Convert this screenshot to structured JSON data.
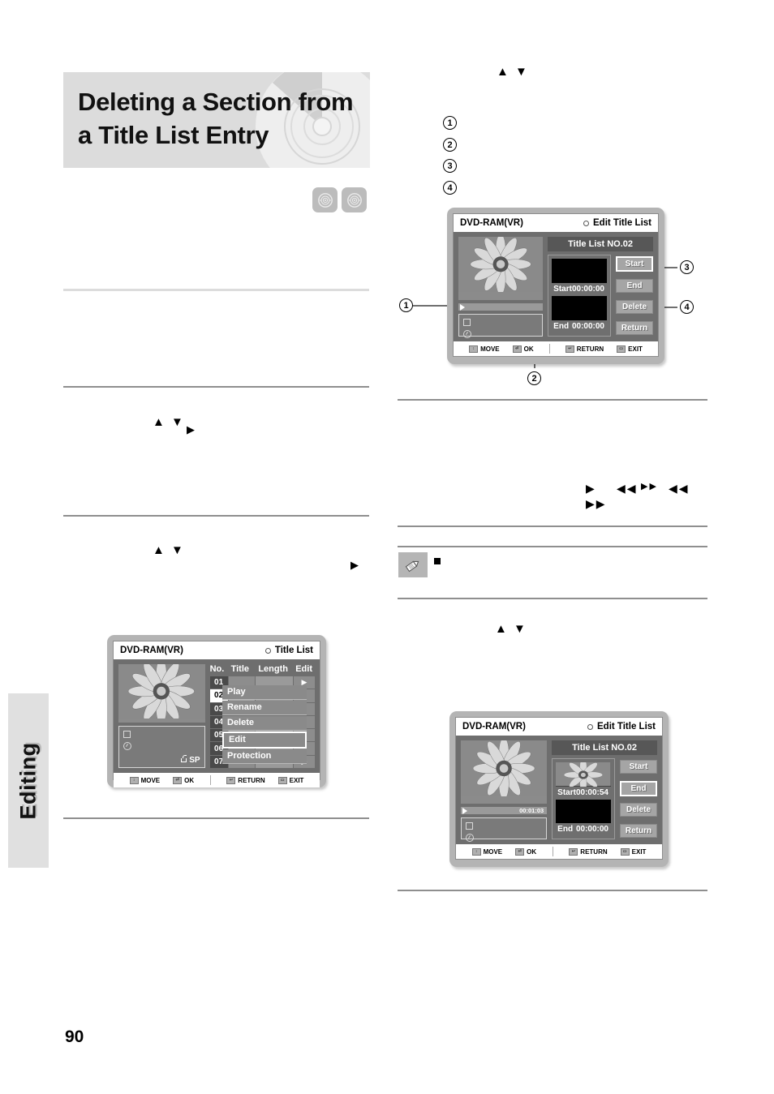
{
  "page": {
    "number": "90",
    "side_tab": "Editing",
    "title": "Deleting a Section from a Title List Entry",
    "title_line1": "Deleting a Section from",
    "title_line2": "a Title List Entry"
  },
  "disc_badges": [
    {
      "name": "dvd-ram-badge"
    },
    {
      "name": "dvd-rw-badge"
    }
  ],
  "markers": {
    "one": "1",
    "two": "2",
    "three": "3",
    "four": "4"
  },
  "glyphs": {
    "up_down": "▲ ▼",
    "right": "▶",
    "play": "▶",
    "rew": "◀◀",
    "ff_small": "▶▶",
    "rew_wide": "◀◀",
    "ff_wide": "▶▶"
  },
  "osd_common": {
    "device": "DVD-RAM(VR)",
    "footer": [
      {
        "key": "↕",
        "label": "MOVE"
      },
      {
        "key": "⏎",
        "label": "OK"
      },
      {
        "key": "↩",
        "label": "RETURN"
      },
      {
        "key": "▭",
        "label": "EXIT"
      }
    ]
  },
  "osd_edit_top": {
    "device": "DVD-RAM(VR)",
    "screen_title": "Edit Title List",
    "list_header": "Title List NO.02",
    "start_label": "Start",
    "start_time": "00:00:00",
    "end_label": "End",
    "end_time": "00:00:00",
    "buttons": [
      {
        "label": "Start",
        "selected": true
      },
      {
        "label": "End",
        "selected": false
      },
      {
        "label": "Delete",
        "selected": false
      },
      {
        "label": "Return",
        "selected": false
      }
    ],
    "progress_time": ""
  },
  "osd_edit_bottom": {
    "device": "DVD-RAM(VR)",
    "screen_title": "Edit Title List",
    "list_header": "Title List NO.02",
    "start_label": "Start",
    "start_time": "00:00:54",
    "end_label": "End",
    "end_time": "00:00:00",
    "buttons": [
      {
        "label": "Start",
        "selected": false
      },
      {
        "label": "End",
        "selected": true
      },
      {
        "label": "Delete",
        "selected": false
      },
      {
        "label": "Return",
        "selected": false
      }
    ],
    "progress_time": "00:01:03"
  },
  "osd_title_list": {
    "device": "DVD-RAM(VR)",
    "screen_title": "Title List",
    "columns": {
      "no": "No.",
      "title": "Title",
      "length": "Length",
      "edit": "Edit"
    },
    "rows": [
      {
        "no": "01",
        "title": "",
        "length": "",
        "edit": "▶",
        "active": false
      },
      {
        "no": "02",
        "title": "",
        "length": "",
        "edit": "",
        "active": true
      },
      {
        "no": "03",
        "title": "",
        "length": "",
        "edit": "",
        "active": false
      },
      {
        "no": "04",
        "title": "",
        "length": "",
        "edit": "",
        "active": false
      },
      {
        "no": "05",
        "title": "",
        "length": "",
        "edit": "",
        "active": false
      },
      {
        "no": "06",
        "title": "",
        "length": "",
        "edit": "",
        "active": false
      },
      {
        "no": "07",
        "title": "",
        "length": "",
        "edit": "▶",
        "active": false
      }
    ],
    "popup_menu": [
      {
        "label": "Play",
        "selected": false
      },
      {
        "label": "Rename",
        "selected": false
      },
      {
        "label": "Delete",
        "selected": false
      },
      {
        "label": "Edit",
        "selected": true
      },
      {
        "label": "Protection",
        "selected": false
      }
    ],
    "record_mode": "SP"
  }
}
